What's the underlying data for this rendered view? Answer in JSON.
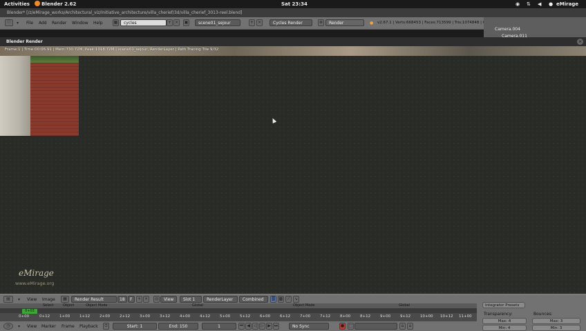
{
  "topbar": {
    "activities": "Activities",
    "app_name": "Blender 2.62",
    "clock": "Sat 23:34",
    "user": "eMirage"
  },
  "window": {
    "title": "Blender* [/z/eMirage_works/Architectural_viz/Initiative_architecture/villa_cherief/3d/villa_cherief_3013-reel.blend]"
  },
  "header": {
    "menus": [
      "File",
      "Add",
      "Render",
      "Window",
      "Help"
    ],
    "screen_layout": "cycles",
    "scene": "scene01_sejour",
    "render_engine": "Cycles Render",
    "render_button": "Render",
    "stats": "v2.67.1 | Verts:668453 | Faces:713599 | Tris:1074848 | Objects:1/654 | Lamps:0/1 | Mem:730.12M (185.46",
    "outliner_items": [
      "Camera.004",
      "Camera.011"
    ]
  },
  "render_window": {
    "title": "Blender Render",
    "info_overlay": "Frame:1 | Time:00:06.91 | Mem:730.72M, Peak:1018.72M | scene01_sejour, RenderLayer | Path Tracing Tile 9/32",
    "logo_text": "eMirage",
    "logo_url": "www.eMirage.org"
  },
  "image_editor_header": {
    "menus": [
      "View",
      "Image"
    ],
    "image_name": "Render Result",
    "users": "18",
    "fake_user": "F",
    "view_menu": "View",
    "slot": "Slot 1",
    "layer": "RenderLayer",
    "pass": "Combined"
  },
  "background_headers": {
    "menus": [
      "View",
      "Select",
      "Object"
    ],
    "mode": "Object Mode",
    "orientation": "Global",
    "mode2": "Object Mode",
    "orientation2": "Global"
  },
  "timeline_ruler": {
    "frame_badge": "0+03",
    "ticks": [
      "0+00",
      "0+12",
      "1+00",
      "1+12",
      "2+00",
      "2+12",
      "3+00",
      "3+12",
      "4+00",
      "4+12",
      "5+00",
      "5+12",
      "6+00",
      "6+12",
      "7+00",
      "7+12",
      "8+00",
      "8+12",
      "9+00",
      "9+12",
      "10+00",
      "10+12",
      "11+00"
    ]
  },
  "timeline": {
    "menus": [
      "View",
      "Marker",
      "Frame",
      "Playback"
    ],
    "start": "Start: 1",
    "end": "End: 150",
    "current": "1",
    "sync": "No Sync"
  },
  "properties_panel": {
    "header": "Integrator Presets",
    "transparency_label": "Transparency:",
    "bounces_label": "Bounces:",
    "transparency_max": "Max: 4",
    "transparency_min": "Min: 4",
    "bounces_max": "Max: 3",
    "bounces_min": "Min: 3"
  }
}
